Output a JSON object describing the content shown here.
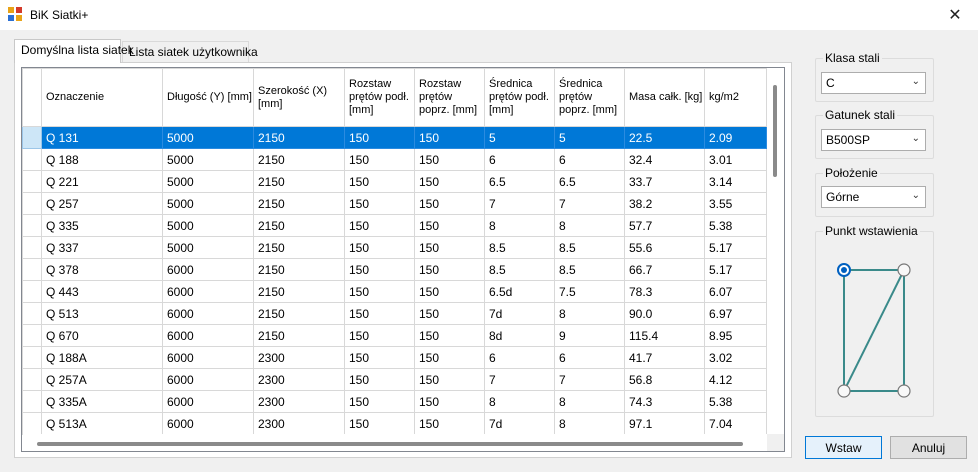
{
  "window": {
    "title": "BiK Siatki+",
    "close_glyph": "✕"
  },
  "tabs": [
    {
      "label": "Domyślna lista siatek",
      "active": true
    },
    {
      "label": "Lista siatek użytkownika",
      "active": false
    }
  ],
  "grid": {
    "columns": [
      "Oznaczenie",
      "Długość (Y) [mm]",
      "Szerokość (X) [mm]",
      "Rozstaw prętów podł. [mm]",
      "Rozstaw prętów poprz. [mm]",
      "Średnica prętów podł. [mm]",
      "Średnica prętów poprz. [mm]",
      "Masa całk. [kg]",
      "kg/m2"
    ],
    "selected_row": 0,
    "rows": [
      [
        "Q 131",
        "5000",
        "2150",
        "150",
        "150",
        "5",
        "5",
        "22.5",
        "2.09"
      ],
      [
        "Q 188",
        "5000",
        "2150",
        "150",
        "150",
        "6",
        "6",
        "32.4",
        "3.01"
      ],
      [
        "Q 221",
        "5000",
        "2150",
        "150",
        "150",
        "6.5",
        "6.5",
        "33.7",
        "3.14"
      ],
      [
        "Q 257",
        "5000",
        "2150",
        "150",
        "150",
        "7",
        "7",
        "38.2",
        "3.55"
      ],
      [
        "Q 335",
        "5000",
        "2150",
        "150",
        "150",
        "8",
        "8",
        "57.7",
        "5.38"
      ],
      [
        "Q 337",
        "5000",
        "2150",
        "150",
        "150",
        "8.5",
        "8.5",
        "55.6",
        "5.17"
      ],
      [
        "Q 378",
        "6000",
        "2150",
        "150",
        "150",
        "8.5",
        "8.5",
        "66.7",
        "5.17"
      ],
      [
        "Q 443",
        "6000",
        "2150",
        "150",
        "150",
        "6.5d",
        "7.5",
        "78.3",
        "6.07"
      ],
      [
        "Q 513",
        "6000",
        "2150",
        "150",
        "150",
        "7d",
        "8",
        "90.0",
        "6.97"
      ],
      [
        "Q 670",
        "6000",
        "2150",
        "150",
        "150",
        "8d",
        "9",
        "115.4",
        "8.95"
      ],
      [
        "Q 188A",
        "6000",
        "2300",
        "150",
        "150",
        "6",
        "6",
        "41.7",
        "3.02"
      ],
      [
        "Q 257A",
        "6000",
        "2300",
        "150",
        "150",
        "7",
        "7",
        "56.8",
        "4.12"
      ],
      [
        "Q 335A",
        "6000",
        "2300",
        "150",
        "150",
        "8",
        "8",
        "74.3",
        "5.38"
      ],
      [
        "Q 513A",
        "6000",
        "2300",
        "150",
        "150",
        "7d",
        "8",
        "97.1",
        "7.04"
      ]
    ]
  },
  "settings": {
    "steel_class": {
      "label": "Klasa stali",
      "value": "C"
    },
    "steel_grade": {
      "label": "Gatunek stali",
      "value": "B500SP"
    },
    "position": {
      "label": "Położenie",
      "value": "Górne"
    },
    "insertion_point": {
      "label": "Punkt wstawienia",
      "selected": "top-left"
    }
  },
  "buttons": {
    "insert": "Wstaw",
    "cancel": "Anuluj"
  },
  "colors": {
    "selection": "#0078d7",
    "diagram_line": "#3a8a8a",
    "point_selected": "#0060c0"
  }
}
